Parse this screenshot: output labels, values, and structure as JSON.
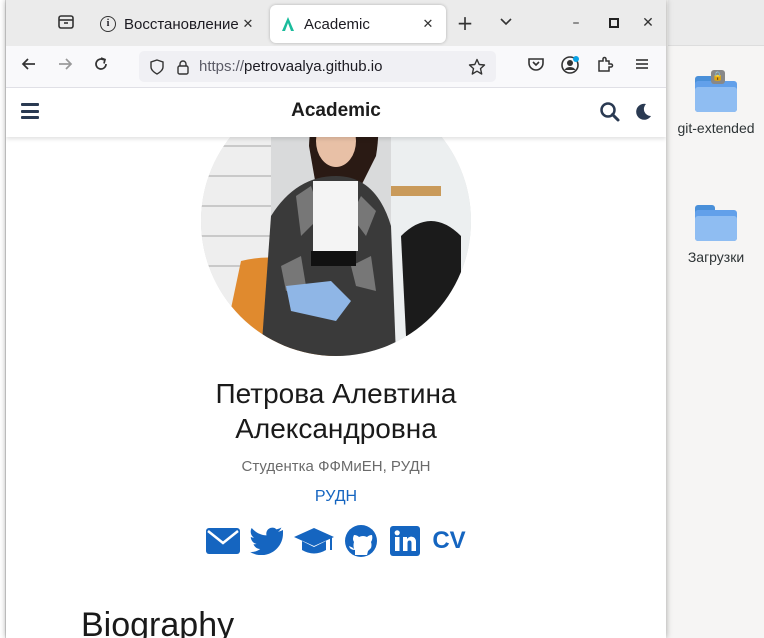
{
  "desktop": {
    "icons": [
      {
        "label": "git-extended"
      },
      {
        "label": "Загрузки"
      }
    ]
  },
  "browser": {
    "tabs": [
      {
        "label": "Восстановление с",
        "icon": "info-icon"
      },
      {
        "label": "Academic",
        "icon": "academic-logo-icon"
      }
    ],
    "url_scheme": "https://",
    "url_host": "petrovaalya.github.io"
  },
  "site": {
    "title": "Academic",
    "accent": "#1565c0"
  },
  "profile": {
    "name_line1": "Петрова Алевтина",
    "name_line2": "Александровна",
    "role": "Студентка ФФМиЕН, РУДН",
    "organization": "РУДН",
    "cv_label": "CV",
    "social_icons": [
      "envelope-icon",
      "twitter-icon",
      "graduation-cap-icon",
      "github-icon",
      "linkedin-icon"
    ]
  },
  "sections": {
    "biography_heading": "Biography"
  }
}
